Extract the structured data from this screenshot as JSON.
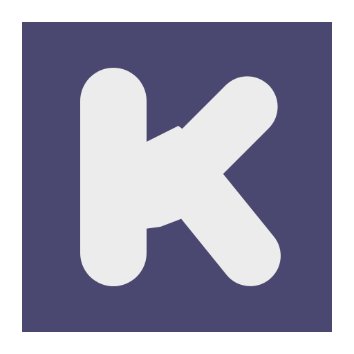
{
  "logo": {
    "icon": "letter-k-logo-icon",
    "background_color": "#4a4870",
    "glyph_color": "#ececec",
    "glyph": "K"
  }
}
